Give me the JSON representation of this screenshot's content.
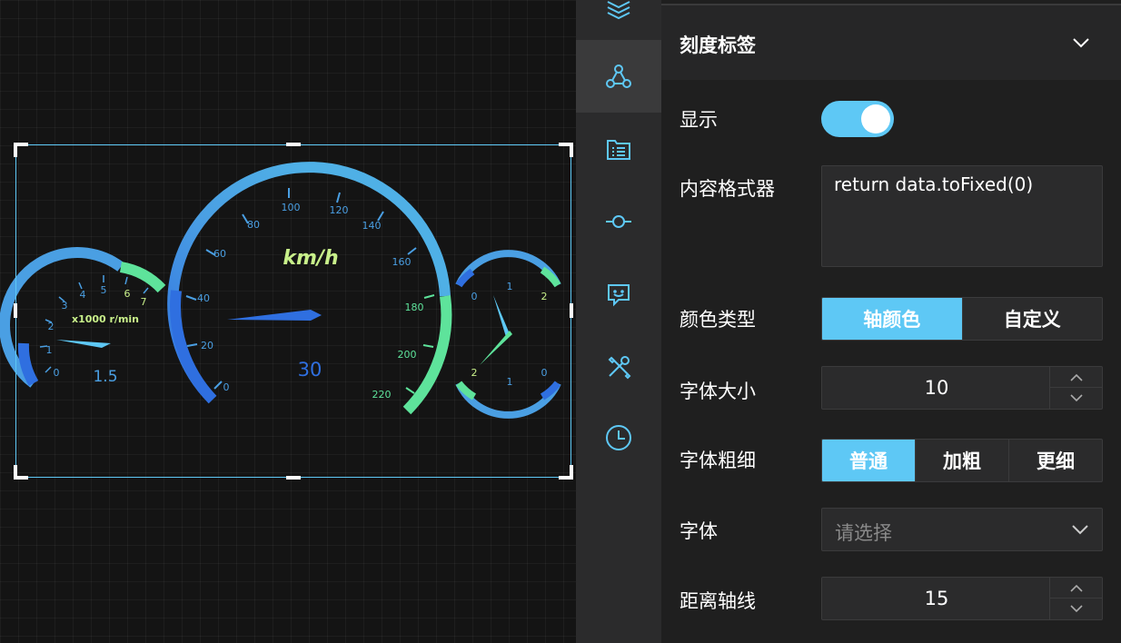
{
  "canvas": {
    "tach": {
      "unit_label": "x1000 r/min",
      "value_text": "1.5",
      "ticks": [
        "0",
        "1",
        "2",
        "3",
        "4",
        "5",
        "6",
        "7"
      ]
    },
    "speedo": {
      "unit_label": "km/h",
      "value_text": "30",
      "ticks": [
        "0",
        "20",
        "40",
        "60",
        "80",
        "100",
        "120",
        "140",
        "160",
        "180",
        "200",
        "220"
      ]
    },
    "fuel": {
      "top_ticks": [
        "0",
        "1",
        "2"
      ],
      "bottom_ticks": [
        "2",
        "1",
        "0"
      ]
    }
  },
  "iconbar": {
    "items": [
      {
        "icon": "layers-icon"
      },
      {
        "icon": "nodes-icon",
        "active": true
      },
      {
        "icon": "list-icon"
      },
      {
        "icon": "axis-line-icon"
      },
      {
        "icon": "tooltip-icon"
      },
      {
        "icon": "tools-icon"
      },
      {
        "icon": "clock-icon"
      }
    ]
  },
  "panel": {
    "title": "刻度标签",
    "show_label": "显示",
    "show_on": true,
    "formatter_label": "内容格式器",
    "formatter_value": "return data.toFixed(0)",
    "color_type_label": "颜色类型",
    "color_type_options": [
      "轴颜色",
      "自定义"
    ],
    "font_size_label": "字体大小",
    "font_size_value": "10",
    "font_weight_label": "字体粗细",
    "font_weight_options": [
      "普通",
      "加粗",
      "更细"
    ],
    "font_family_label": "字体",
    "font_family_placeholder": "请选择",
    "distance_label": "距离轴线",
    "distance_value": "15"
  },
  "colors": {
    "accent": "#5ec8f5",
    "gauge_blue": "#4a9fe3",
    "gauge_dark": "#2f6fe0",
    "gauge_green": "#5ee39b",
    "unit_text": "#c8f08a"
  }
}
